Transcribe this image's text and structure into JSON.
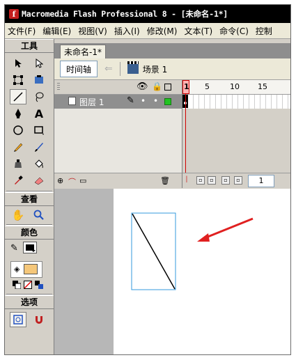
{
  "titlebar": {
    "icon": "f",
    "title": "Macromedia Flash Professional 8 - [未命名-1*]"
  },
  "menu": [
    "文件(F)",
    "编辑(E)",
    "视图(V)",
    "插入(I)",
    "修改(M)",
    "文本(T)",
    "命令(C)",
    "控制"
  ],
  "tools": {
    "header": "工具",
    "view_header": "查看",
    "color_header": "颜色",
    "options_header": "选项"
  },
  "document": {
    "tab": "未命名-1*",
    "timeline_button": "时间轴",
    "scene_label": "场景 1"
  },
  "timeline": {
    "layer_name": "图层 1",
    "frame_numbers": [
      "1",
      "5",
      "10",
      "15"
    ],
    "current_frame": "1"
  },
  "colors": {
    "stroke": "#000000",
    "fill": "#f5c77a",
    "arrow": "#e02020",
    "shape_outline": "#3399dd"
  }
}
